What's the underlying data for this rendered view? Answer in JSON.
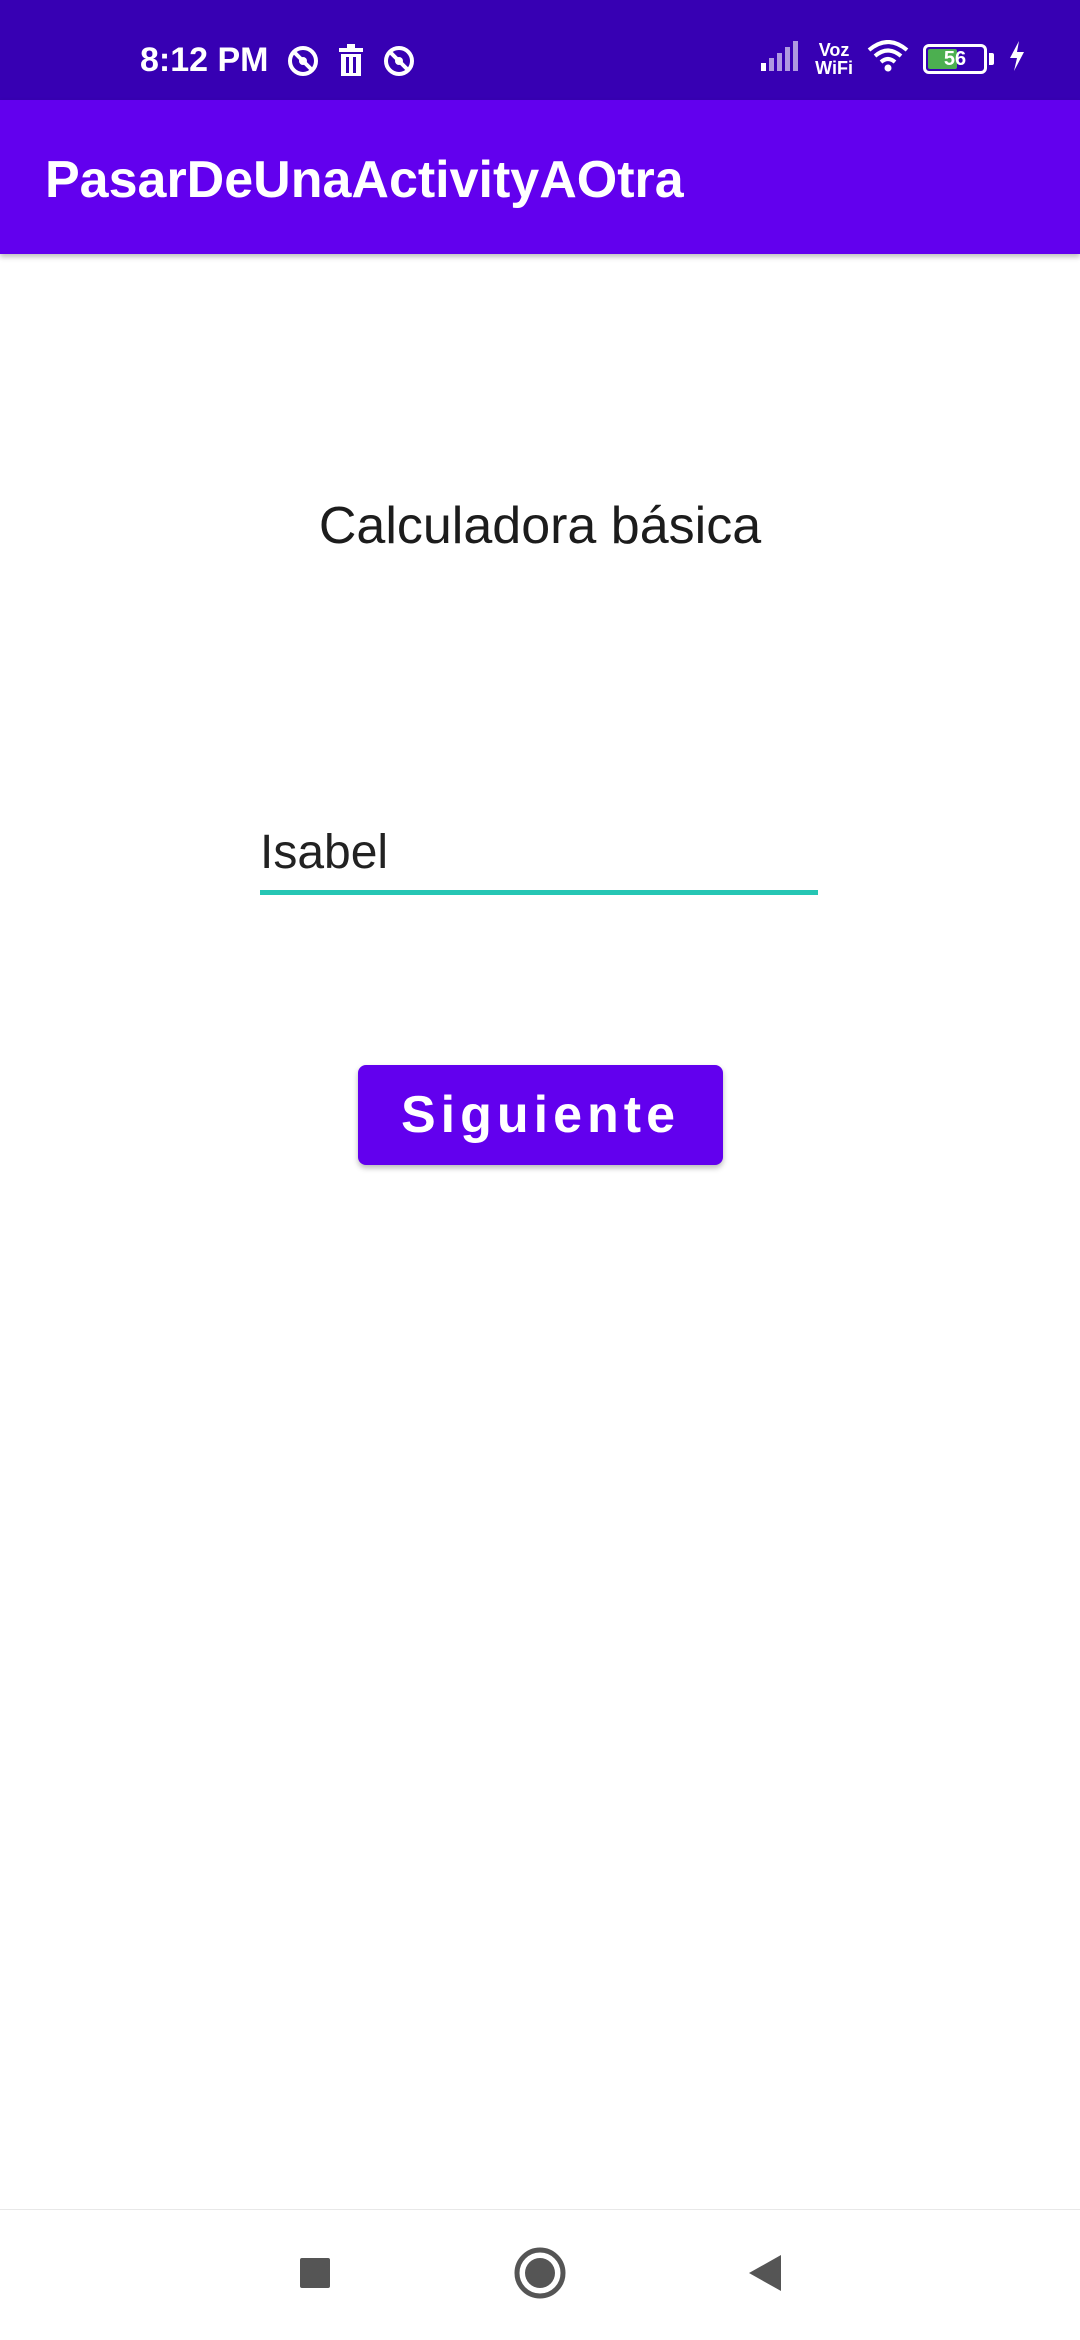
{
  "status_bar": {
    "time": "8:12 PM",
    "left_icons": [
      "nfc-off-icon",
      "trash-icon",
      "nfc-off-icon"
    ],
    "signal_icon": "signal-bars-icon",
    "voz_label": "Voz",
    "wifi_label": "WiFi",
    "wifi_icon": "wifi-icon",
    "battery_level": "56",
    "charging_icon": "lightning-icon"
  },
  "app_bar": {
    "title": "PasarDeUnaActivityAOtra",
    "color": "#6200EE"
  },
  "main": {
    "heading": "Calculadora básica",
    "name_field": {
      "value": "Isabel",
      "underline_color": "#26C6B4"
    },
    "next_button": {
      "label": "Siguiente"
    }
  },
  "nav_bar": {
    "recents_icon": "square-icon",
    "home_icon": "circle-icon",
    "back_icon": "triangle-back-icon"
  },
  "colors": {
    "status_bar": "#3700B3",
    "accent": "#6200EE",
    "field_underline": "#26C6B4"
  }
}
